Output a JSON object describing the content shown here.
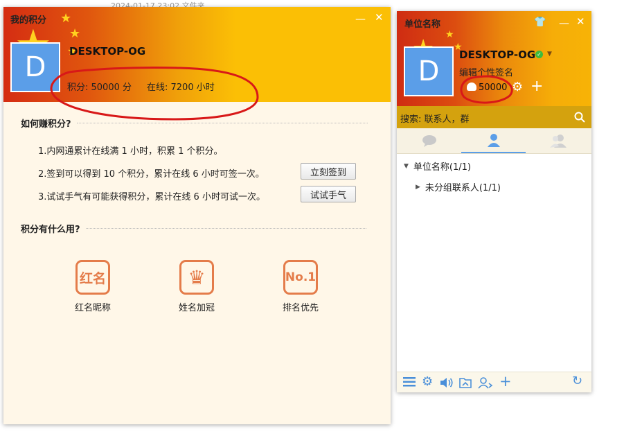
{
  "background": {
    "top_fragment": "2024-01-17 23:02        文件夹"
  },
  "points_window": {
    "title": "我的积分",
    "avatar_letter": "D",
    "username": "DESKTOP-OG",
    "points_label": "积分: 50000 分",
    "online_label": "在线: 7200 小时",
    "how_earn_heading": "如何赚积分?",
    "rules": [
      "1.内网通累计在线满 1 小时，积累 1 个积分。",
      "2.签到可以得到 10 个积分，累计在线 6 小时可签一次。",
      "3.试试手气有可能获得积分，累计在线 6 小时可试一次。"
    ],
    "checkin_button": "立刻签到",
    "luck_button": "试试手气",
    "uses_heading": "积分有什么用?",
    "uses": [
      {
        "icon_text": "红名",
        "label": "红名昵称",
        "icon": "red-name-icon"
      },
      {
        "icon_text": "♛",
        "label": "姓名加冠",
        "icon": "crown-icon"
      },
      {
        "icon_text": "No.1",
        "label": "排名优先",
        "icon": "rank-first-icon"
      }
    ]
  },
  "main_panel": {
    "title": "单位名称",
    "avatar_letter": "D",
    "username": "DESKTOP-OG",
    "signature": "编辑个性签名",
    "points": "50000",
    "search_placeholder": "搜索: 联系人，群",
    "tree": [
      {
        "label": "单位名称(1/1)",
        "expanded": true
      },
      {
        "label": "未分组联系人(1/1)",
        "expanded": false
      }
    ]
  },
  "colors": {
    "avatar": "#5b9ee8",
    "accent_orange": "#e47c4a",
    "header_yellow": "#fbbf05",
    "search_bar": "#d4a20e",
    "scribble": "#d81818",
    "online_green": "#3dbb3d"
  }
}
